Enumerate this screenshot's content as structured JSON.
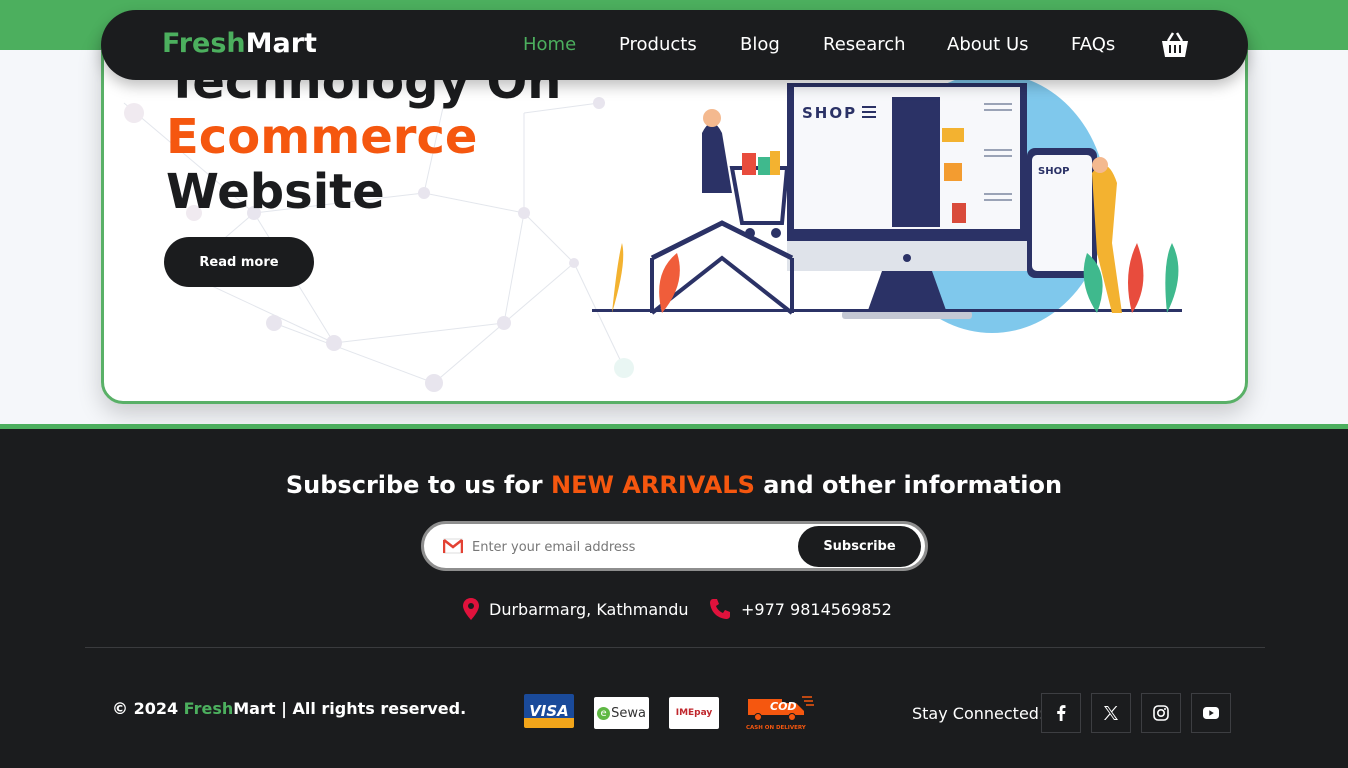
{
  "nav": {
    "logo_fresh": "Fresh",
    "logo_mart": "Mart",
    "items": [
      "Home",
      "Products",
      "Blog",
      "Research",
      "About Us",
      "FAQs"
    ],
    "active": "Home"
  },
  "hero": {
    "line1": "Technology On",
    "line2": "Ecommerce",
    "line3": "Website",
    "button": "Read more",
    "illustration": {
      "shop_label": "SHOP",
      "phone_label": "SHOP"
    }
  },
  "footer": {
    "subscribe_prefix": "Subscribe to us for ",
    "subscribe_accent": "NEW ARRIVALS",
    "subscribe_suffix": " and other information",
    "email_placeholder": "Enter your email address",
    "subscribe_button": "Subscribe",
    "address": "Durbarmarg, Kathmandu",
    "phone": "+977 9814569852",
    "copyright_prefix": "© 2024 ",
    "copyright_fresh": "Fresh",
    "copyright_suffix": "Mart | All rights reserved.",
    "payments": {
      "visa": "VISA",
      "esewa": "Sewa",
      "ime": "IMEpay",
      "cod": "COD",
      "cod_sub": "CASH ON DELIVERY"
    },
    "stay_connected": "Stay Connected:",
    "socials": [
      "facebook-icon",
      "x-icon",
      "instagram-icon",
      "youtube-icon"
    ]
  },
  "colors": {
    "green": "#4caf5e",
    "orange": "#f5570f",
    "dark": "#1b1c1e"
  }
}
